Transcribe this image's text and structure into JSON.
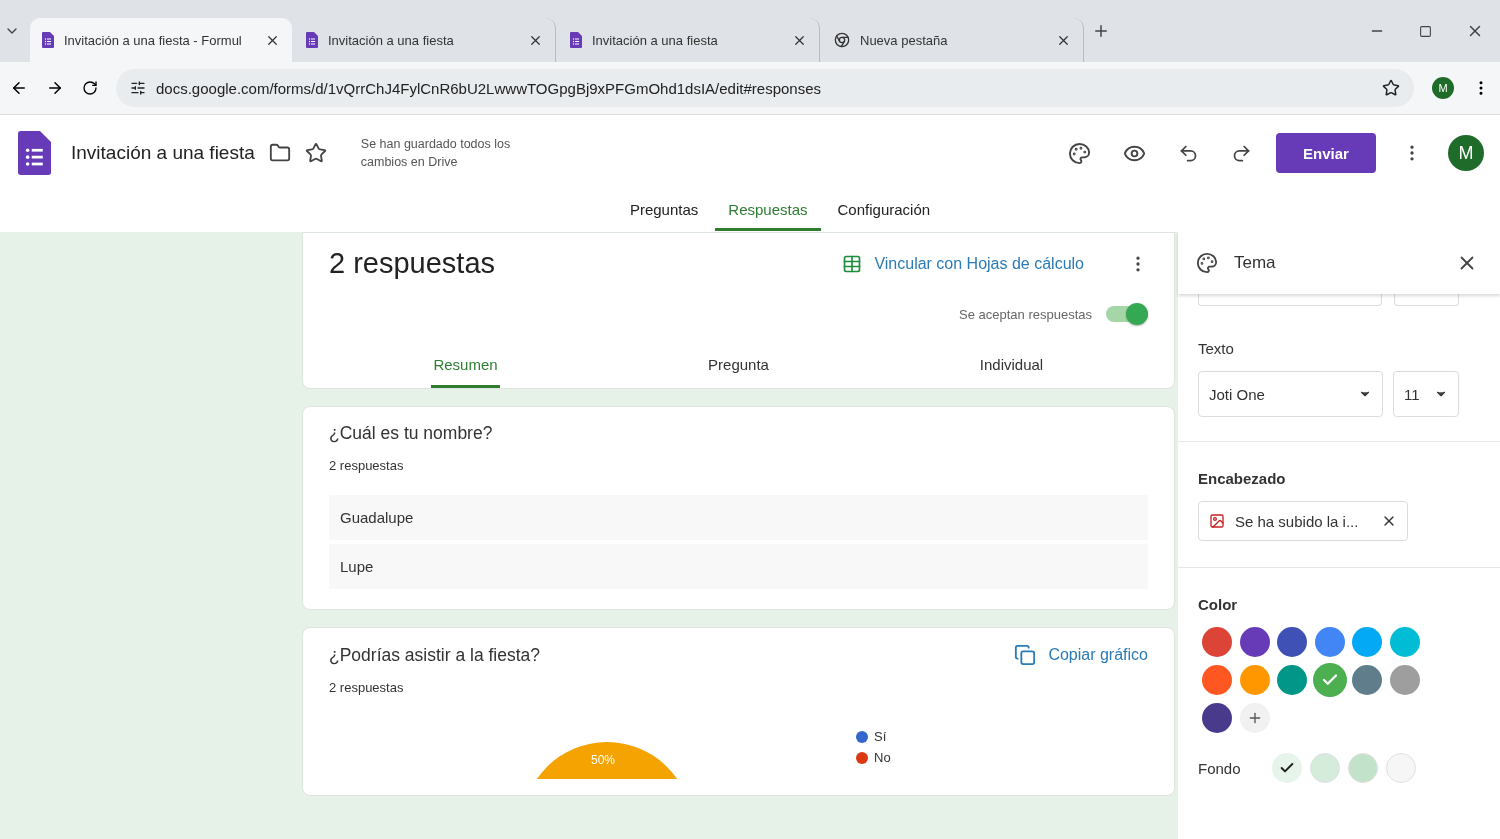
{
  "browser": {
    "tabs": [
      {
        "title": "Invitación a una fiesta - Formul",
        "selected": true
      },
      {
        "title": "Invitación a una fiesta",
        "selected": false
      },
      {
        "title": "Invitación a una fiesta",
        "selected": false
      },
      {
        "title": "Nueva pestaña",
        "selected": false
      }
    ],
    "url": "docs.google.com/forms/d/1vQrrChJ4FylCnR6bU2LwwwTOGpgBj9xPFGmOhd1dsIA/edit#responses",
    "profile": "M"
  },
  "header": {
    "title": "Invitación a una fiesta",
    "save_status": "Se han guardado todos los cambios en Drive",
    "send": "Enviar",
    "avatar": "M"
  },
  "tabs": [
    {
      "label": "Preguntas",
      "selected": false
    },
    {
      "label": "Respuestas",
      "selected": true
    },
    {
      "label": "Configuración",
      "selected": false
    }
  ],
  "summary": {
    "count": "2 respuestas",
    "link": "Vincular con Hojas de cálculo",
    "accepting_label": "Se aceptan respuestas",
    "accepting": true,
    "views": [
      {
        "label": "Resumen",
        "selected": true
      },
      {
        "label": "Pregunta",
        "selected": false
      },
      {
        "label": "Individual",
        "selected": false
      }
    ]
  },
  "questions": [
    {
      "kind": "text",
      "title": "¿Cuál es tu nombre?",
      "count": "2 respuestas",
      "answers": [
        "Guadalupe",
        "Lupe"
      ]
    },
    {
      "kind": "pie",
      "title": "¿Podrías asistir a la fiesta?",
      "count": "2 respuestas",
      "copy": "Copiar gráfico",
      "slice_label": "50%",
      "legend": [
        {
          "label": "Sí",
          "color": "#3366cc"
        },
        {
          "label": "No",
          "color": "#dc3912"
        }
      ]
    }
  ],
  "theme_panel": {
    "title": "Tema",
    "text_label": "Texto",
    "font": "Joti One",
    "size": "11",
    "header_label": "Encabezado",
    "header_chip": "Se ha subido la i...",
    "color_label": "Color",
    "colors": [
      {
        "color": "#db4437",
        "selected": false
      },
      {
        "color": "#673ab7",
        "selected": false
      },
      {
        "color": "#3f51b5",
        "selected": false
      },
      {
        "color": "#4285f4",
        "selected": false
      },
      {
        "color": "#03a9f4",
        "selected": false
      },
      {
        "color": "#00bcd4",
        "selected": false
      },
      {
        "color": "#ff5722",
        "selected": false
      },
      {
        "color": "#ff9800",
        "selected": false
      },
      {
        "color": "#009688",
        "selected": false
      },
      {
        "color": "#4caf50",
        "selected": true
      },
      {
        "color": "#607d8b",
        "selected": false
      },
      {
        "color": "#9e9e9e",
        "selected": false
      },
      {
        "color": "#4a3a8c",
        "selected": false
      }
    ],
    "background_label": "Fondo",
    "backgrounds": [
      {
        "color": "#e6f4ea",
        "selected": true
      },
      {
        "color": "#d4ecd9",
        "selected": false
      },
      {
        "color": "#c2e3c9",
        "selected": false
      },
      {
        "color": "#f6f6f6",
        "selected": false
      }
    ]
  }
}
